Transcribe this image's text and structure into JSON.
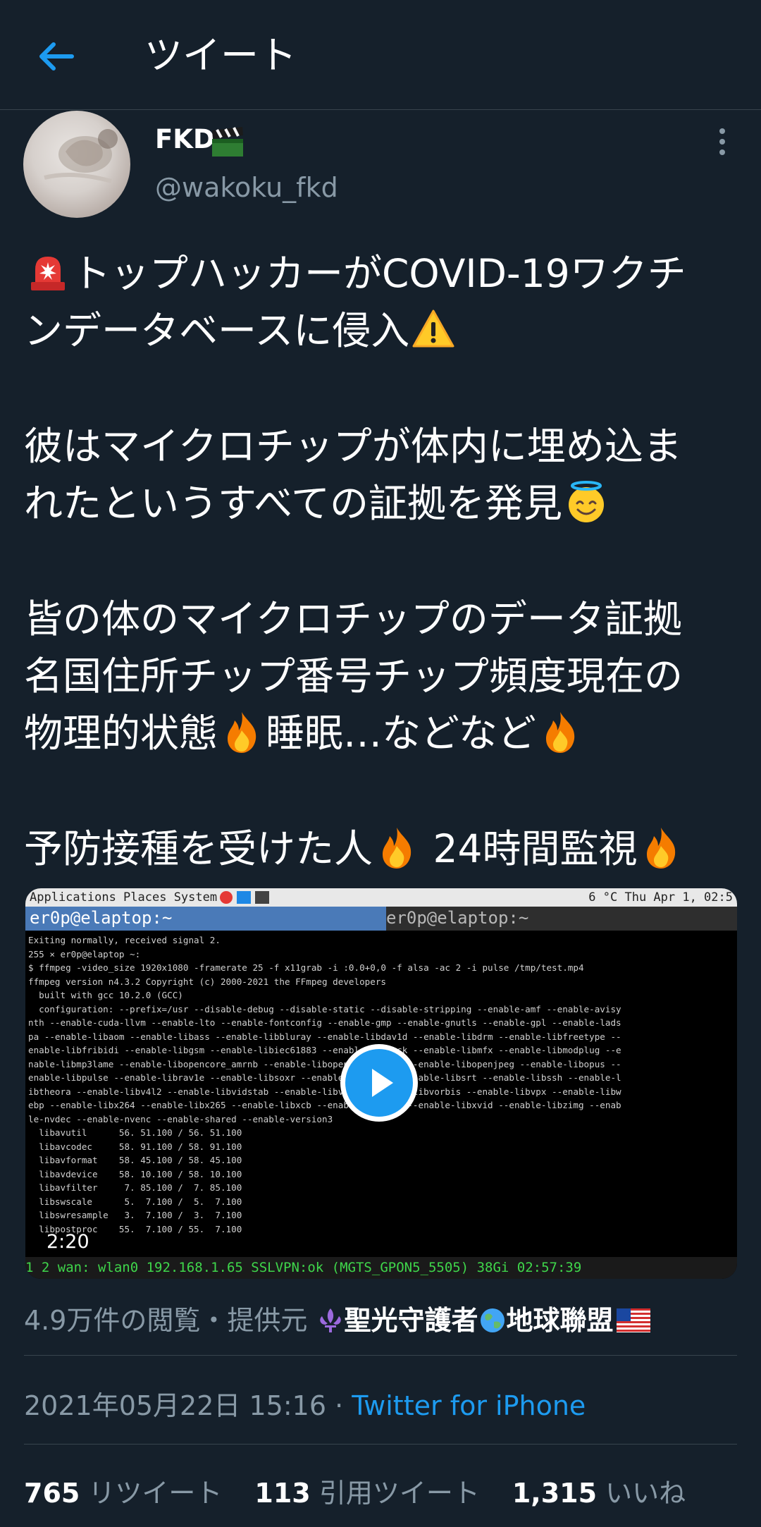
{
  "header": {
    "title": "ツイート"
  },
  "author": {
    "display_name": "FKD",
    "handle": "@wakoku_fkd"
  },
  "tweet": {
    "lines": [
      "トップハッカーがCOVID-19ワクチ",
      "ンデータベースに侵入",
      "彼はマイクロチップが体内に埋め込ま",
      "れたというすべての証拠を発見",
      "皆の体のマイクロチップのデータ証拠",
      "名国住所チップ番号チップ頻度現在の",
      "物理的状態",
      "睡眠…などなど",
      "予防接種を受けた人",
      " 24時間監視"
    ]
  },
  "media": {
    "duration": "2:20",
    "gnome_bar": "Applications Places System",
    "gnome_clock": "6 °C Thu Apr  1, 02:5",
    "tab_active": "er0p@elaptop:~",
    "tab_inactive": "er0p@elaptop:~",
    "terminal_lines": [
      "Exiting normally, received signal 2.",
      "255 × er0p@elaptop ~:",
      "$ ffmpeg -video_size 1920x1080 -framerate 25 -f x11grab -i :0.0+0,0 -f alsa -ac 2 -i pulse /tmp/test.mp4",
      "ffmpeg version n4.3.2 Copyright (c) 2000-2021 the FFmpeg developers",
      "  built with gcc 10.2.0 (GCC)",
      "  configuration: --prefix=/usr --disable-debug --disable-static --disable-stripping --enable-amf --enable-avisy",
      "nth --enable-cuda-llvm --enable-lto --enable-fontconfig --enable-gmp --enable-gnutls --enable-gpl --enable-lads",
      "pa --enable-libaom --enable-libass --enable-libbluray --enable-libdav1d --enable-libdrm --enable-libfreetype --",
      "enable-libfribidi --enable-libgsm --enable-libiec61883 --enable-libjack --enable-libmfx --enable-libmodplug --e",
      "nable-libmp3lame --enable-libopencore_amrnb --enable-libopencore_amrwb --enable-libopenjpeg --enable-libopus --",
      "enable-libpulse --enable-librav1e --enable-libsoxr --enable-libspeex --enable-libsrt --enable-libssh --enable-l",
      "ibtheora --enable-libv4l2 --enable-libvidstab --enable-libvmaf --enable-libvorbis --enable-libvpx --enable-libw",
      "ebp --enable-libx264 --enable-libx265 --enable-libxcb --enable-libxml2 --enable-libxvid --enable-libzimg --enab",
      "le-nvdec --enable-nvenc --enable-shared --enable-version3",
      "  libavutil      56. 51.100 / 56. 51.100",
      "  libavcodec     58. 91.100 / 58. 91.100",
      "  libavformat    58. 45.100 / 58. 45.100",
      "  libavdevice    58. 10.100 / 58. 10.100",
      "  libavfilter     7. 85.100 /  7. 85.100",
      "  libswscale      5.  7.100 /  5.  7.100",
      "  libswresample   3.  7.100 /  3.  7.100",
      "  libpostproc    55.  7.100 / 55.  7.100"
    ],
    "status_bar": "1 2   wan: wlan0 192.168.1.65   SSLVPN:ok (MGTS_GPON5_5505) 38Gi 02:57:39"
  },
  "views": {
    "prefix": "4.9万件の閲覧・提供元 ",
    "source_a": "聖光守護者",
    "source_b": "地球聯盟"
  },
  "meta": {
    "date": "2021年05月22日 15:16 · ",
    "client": "Twitter for iPhone"
  },
  "stats": {
    "retweets_count": "765",
    "retweets_label": " リツイート",
    "quotes_count": "113",
    "quotes_label": " 引用ツイート",
    "likes_count": "1,315",
    "likes_label": " いいね"
  },
  "colors": {
    "background": "#15202b",
    "accent": "#1d9bf0",
    "secondary_text": "#8899a6",
    "divider": "#38444d"
  },
  "icons": [
    "back-arrow-icon",
    "clapper-board-icon",
    "more-vertical-icon",
    "rotating-light-icon",
    "warning-icon",
    "smiling-face-with-halo-icon",
    "fire-icon",
    "play-icon",
    "fleur-de-lis-icon",
    "globe-icon",
    "us-flag-icon"
  ]
}
